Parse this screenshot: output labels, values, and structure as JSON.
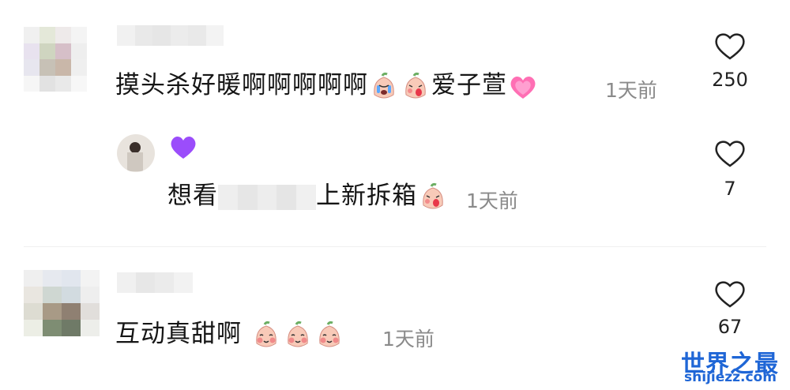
{
  "comments": [
    {
      "text": "摸头杀好暖啊啊啊啊啊",
      "suffix": "爱子萱",
      "time": "1天前",
      "likes": "250",
      "emoji_after_text": [
        "crying-face-icon",
        "tongue-face-icon"
      ],
      "emoji_after_suffix": "pink-heart-icon"
    },
    {
      "text_before": "想看",
      "text_after": "上新拆箱",
      "time": "1天前",
      "likes": "7",
      "name_emoji": "purple-heart-icon",
      "emoji_after_text": [
        "tongue-face-icon"
      ]
    },
    {
      "text": "互动真甜啊",
      "time": "1天前",
      "likes": "67",
      "emoji_after_text": [
        "blush-face-icon",
        "blush-face-icon",
        "blush-face-icon"
      ]
    }
  ],
  "watermark": {
    "title": "世界之最",
    "url": "shijiezz.com"
  },
  "colors": {
    "text": "#161616",
    "muted": "#8a8a8a",
    "watermark": "#1f66d6",
    "emoji_face": "#f8cab8",
    "heart_pink": "#ff6fb4",
    "heart_purple": "#9b4dfb"
  }
}
